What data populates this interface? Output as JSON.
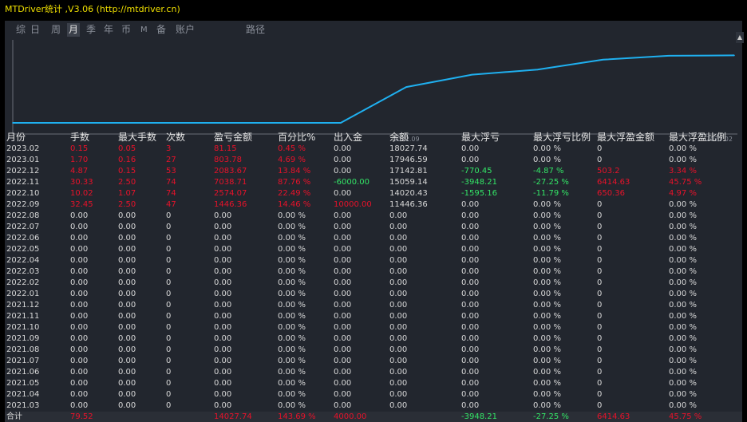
{
  "window": {
    "title": "MTDriver统计 ,V3.06 (http://mtdriver.cn)"
  },
  "tabs": [
    {
      "label": "综",
      "active": false
    },
    {
      "label": "日",
      "active": false
    },
    {
      "label": "周",
      "active": false
    },
    {
      "label": "月",
      "active": true
    },
    {
      "label": "季",
      "active": false
    },
    {
      "label": "年",
      "active": false
    },
    {
      "label": "币",
      "active": false
    },
    {
      "label": "M",
      "active": false
    },
    {
      "label": "备",
      "active": false
    },
    {
      "label": "账户",
      "active": false
    },
    {
      "label": "路径",
      "active": false
    }
  ],
  "chart_data": {
    "type": "line",
    "x_tick_labels": [
      "2022.09",
      "2023.02"
    ],
    "x": [
      "2022.03",
      "2022.04",
      "2022.05",
      "2022.06",
      "2022.07",
      "2022.08",
      "2022.09",
      "2022.10",
      "2022.11",
      "2022.12",
      "2023.01",
      "2023.02"
    ],
    "values": [
      4000,
      4000,
      4000,
      4000,
      4000,
      4000,
      11446.36,
      14020.43,
      15059.14,
      17142.81,
      17946.59,
      18027.74
    ],
    "line_color": "#1fb0f0",
    "grid": false
  },
  "table": {
    "headers": [
      "月份",
      "手数",
      "最大手数",
      "次数",
      "盈亏金额",
      "百分比%",
      "出入金",
      "余额",
      "最大浮亏",
      "最大浮亏比例",
      "最大浮盈金额",
      "最大浮盈比例"
    ],
    "rows": [
      [
        "2023.02",
        "0.15",
        "0.05",
        "3",
        "81.15",
        "0.45 %",
        "0.00",
        "18027.74",
        "0.00",
        "0.00 %",
        "0",
        "0.00 %"
      ],
      [
        "2023.01",
        "1.70",
        "0.16",
        "27",
        "803.78",
        "4.69 %",
        "0.00",
        "17946.59",
        "0.00",
        "0.00 %",
        "0",
        "0.00 %"
      ],
      [
        "2022.12",
        "4.87",
        "0.15",
        "53",
        "2083.67",
        "13.84 %",
        "0.00",
        "17142.81",
        "-770.45",
        "-4.87 %",
        "503.2",
        "3.34 %"
      ],
      [
        "2022.11",
        "30.33",
        "2.50",
        "74",
        "7038.71",
        "87.76 %",
        "-6000.00",
        "15059.14",
        "-3948.21",
        "-27.25 %",
        "6414.63",
        "45.75 %"
      ],
      [
        "2022.10",
        "10.02",
        "1.07",
        "74",
        "2574.07",
        "22.49 %",
        "0.00",
        "14020.43",
        "-1595.16",
        "-11.79 %",
        "650.36",
        "4.97 %"
      ],
      [
        "2022.09",
        "32.45",
        "2.50",
        "47",
        "1446.36",
        "14.46 %",
        "10000.00",
        "11446.36",
        "0.00",
        "0.00 %",
        "0",
        "0.00 %"
      ],
      [
        "2022.08",
        "0.00",
        "0.00",
        "0",
        "0.00",
        "0.00 %",
        "0.00",
        "0.00",
        "0.00",
        "0.00 %",
        "0",
        "0.00 %"
      ],
      [
        "2022.07",
        "0.00",
        "0.00",
        "0",
        "0.00",
        "0.00 %",
        "0.00",
        "0.00",
        "0.00",
        "0.00 %",
        "0",
        "0.00 %"
      ],
      [
        "2022.06",
        "0.00",
        "0.00",
        "0",
        "0.00",
        "0.00 %",
        "0.00",
        "0.00",
        "0.00",
        "0.00 %",
        "0",
        "0.00 %"
      ],
      [
        "2022.05",
        "0.00",
        "0.00",
        "0",
        "0.00",
        "0.00 %",
        "0.00",
        "0.00",
        "0.00",
        "0.00 %",
        "0",
        "0.00 %"
      ],
      [
        "2022.04",
        "0.00",
        "0.00",
        "0",
        "0.00",
        "0.00 %",
        "0.00",
        "0.00",
        "0.00",
        "0.00 %",
        "0",
        "0.00 %"
      ],
      [
        "2022.03",
        "0.00",
        "0.00",
        "0",
        "0.00",
        "0.00 %",
        "0.00",
        "0.00",
        "0.00",
        "0.00 %",
        "0",
        "0.00 %"
      ],
      [
        "2022.02",
        "0.00",
        "0.00",
        "0",
        "0.00",
        "0.00 %",
        "0.00",
        "0.00",
        "0.00",
        "0.00 %",
        "0",
        "0.00 %"
      ],
      [
        "2022.01",
        "0.00",
        "0.00",
        "0",
        "0.00",
        "0.00 %",
        "0.00",
        "0.00",
        "0.00",
        "0.00 %",
        "0",
        "0.00 %"
      ],
      [
        "2021.12",
        "0.00",
        "0.00",
        "0",
        "0.00",
        "0.00 %",
        "0.00",
        "0.00",
        "0.00",
        "0.00 %",
        "0",
        "0.00 %"
      ],
      [
        "2021.11",
        "0.00",
        "0.00",
        "0",
        "0.00",
        "0.00 %",
        "0.00",
        "0.00",
        "0.00",
        "0.00 %",
        "0",
        "0.00 %"
      ],
      [
        "2021.10",
        "0.00",
        "0.00",
        "0",
        "0.00",
        "0.00 %",
        "0.00",
        "0.00",
        "0.00",
        "0.00 %",
        "0",
        "0.00 %"
      ],
      [
        "2021.09",
        "0.00",
        "0.00",
        "0",
        "0.00",
        "0.00 %",
        "0.00",
        "0.00",
        "0.00",
        "0.00 %",
        "0",
        "0.00 %"
      ],
      [
        "2021.08",
        "0.00",
        "0.00",
        "0",
        "0.00",
        "0.00 %",
        "0.00",
        "0.00",
        "0.00",
        "0.00 %",
        "0",
        "0.00 %"
      ],
      [
        "2021.07",
        "0.00",
        "0.00",
        "0",
        "0.00",
        "0.00 %",
        "0.00",
        "0.00",
        "0.00",
        "0.00 %",
        "0",
        "0.00 %"
      ],
      [
        "2021.06",
        "0.00",
        "0.00",
        "0",
        "0.00",
        "0.00 %",
        "0.00",
        "0.00",
        "0.00",
        "0.00 %",
        "0",
        "0.00 %"
      ],
      [
        "2021.05",
        "0.00",
        "0.00",
        "0",
        "0.00",
        "0.00 %",
        "0.00",
        "0.00",
        "0.00",
        "0.00 %",
        "0",
        "0.00 %"
      ],
      [
        "2021.04",
        "0.00",
        "0.00",
        "0",
        "0.00",
        "0.00 %",
        "0.00",
        "0.00",
        "0.00",
        "0.00 %",
        "0",
        "0.00 %"
      ],
      [
        "2021.03",
        "0.00",
        "0.00",
        "0",
        "0.00",
        "0.00 %",
        "0.00",
        "0.00",
        "0.00",
        "0.00 %",
        "0",
        "0.00 %"
      ]
    ],
    "total": [
      "合计",
      "79.52",
      "",
      "",
      "14027.74",
      "143.69 %",
      "4000.00",
      "",
      "-3948.21",
      "-27.25 %",
      "6414.63",
      "45.75 %"
    ]
  },
  "colors": {
    "red": "#e8122a",
    "green": "#33e466",
    "neutral": "#d8d8d8",
    "title": "#f0e000"
  }
}
